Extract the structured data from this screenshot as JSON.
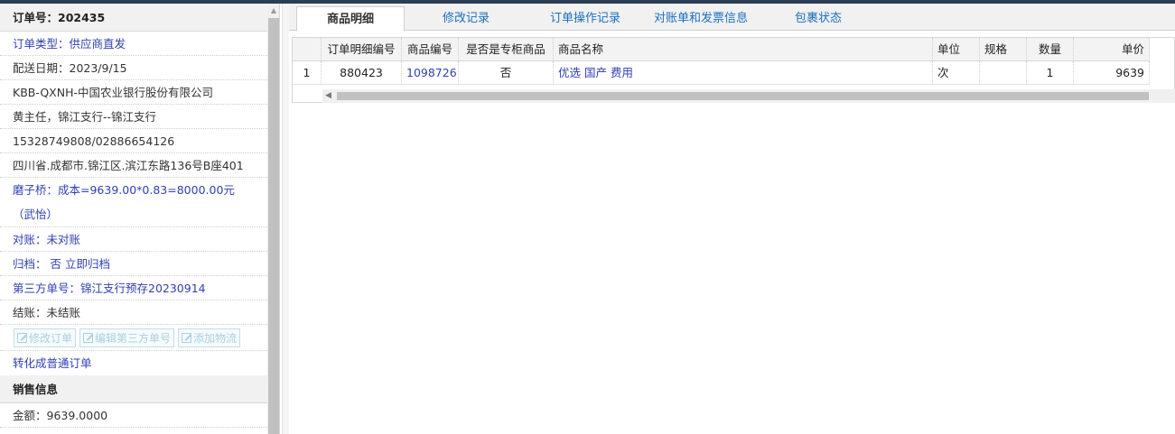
{
  "order": {
    "number_label": "订单号：202435",
    "type": "订单类型：供应商直发",
    "delivery_date": "配送日期：2023/9/15",
    "customer": "KBB-QXNH-中国农业银行股份有限公司",
    "contact": "黄主任，锦江支行--锦江支行",
    "phones": "15328749808/02886654126",
    "address": "四川省.成都市.锦江区.滨江东路136号B座401",
    "cost_note": "磨子桥：成本=9639.00*0.83=8000.00元（武怡）",
    "reconcile": "对账：未对账",
    "archive": "归档： 否 立即归档",
    "third_party": "第三方单号：锦江支行预存20230914",
    "settle": "结账：未结账",
    "buttons": {
      "edit_order": "修改订单",
      "edit_third_party": "编辑第三方单号",
      "add_logistics": "添加物流"
    },
    "convert_link": "转化成普通订单"
  },
  "sales": {
    "header": "销售信息",
    "amount": "金额：9639.0000"
  },
  "tabs": [
    "商品明细",
    "修改记录",
    "订单操作记录",
    "对账单和发票信息",
    "包裹状态"
  ],
  "grid": {
    "headers": [
      "",
      "订单明细编号",
      "商品编号",
      "是否是专柜商品",
      "商品名称",
      "单位",
      "规格",
      "数量",
      "单价"
    ],
    "rows": [
      [
        "1",
        "880423",
        "1098726",
        "否",
        "优选 国产 费用",
        "次",
        "",
        "1",
        "9639"
      ]
    ]
  },
  "colors": {
    "link": "#2f3fb5",
    "tab_text": "#1a6fc0",
    "top_strip": "#2d3d55"
  }
}
